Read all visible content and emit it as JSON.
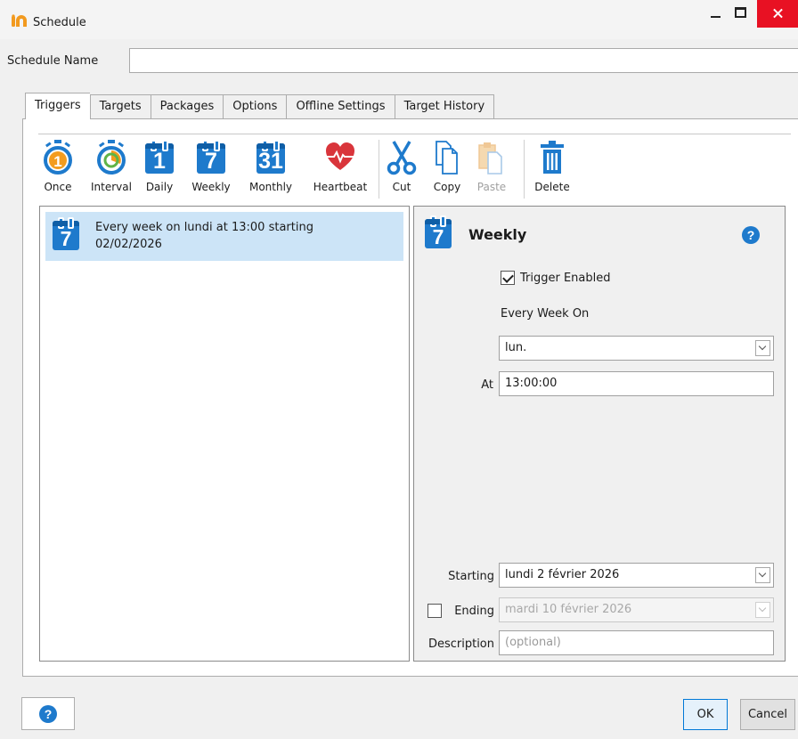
{
  "window": {
    "title": "Schedule"
  },
  "schedule_name": {
    "label": "Schedule Name",
    "value": ""
  },
  "tabs": [
    {
      "label": "Triggers",
      "active": true
    },
    {
      "label": "Targets"
    },
    {
      "label": "Packages"
    },
    {
      "label": "Options"
    },
    {
      "label": "Offline Settings"
    },
    {
      "label": "Target History"
    }
  ],
  "toolbar": {
    "once": {
      "label": "Once",
      "icon": "stopwatch-once-icon"
    },
    "interval": {
      "label": "Interval",
      "icon": "stopwatch-interval-icon"
    },
    "daily": {
      "label": "Daily",
      "icon": "calendar-day-icon",
      "number": "1"
    },
    "weekly": {
      "label": "Weekly",
      "icon": "calendar-week-icon",
      "number": "7"
    },
    "monthly": {
      "label": "Monthly",
      "icon": "calendar-month-icon",
      "number": "31"
    },
    "heartbeat": {
      "label": "Heartbeat",
      "icon": "heartbeat-icon"
    },
    "cut": {
      "label": "Cut",
      "icon": "scissors-icon"
    },
    "copy": {
      "label": "Copy",
      "icon": "copy-icon"
    },
    "paste": {
      "label": "Paste",
      "icon": "paste-icon",
      "disabled": true
    },
    "delete": {
      "label": "Delete",
      "icon": "trash-icon"
    }
  },
  "triggers_list": [
    {
      "icon_number": "7",
      "text": "Every week on lundi at 13:00 starting 02/02/2026"
    }
  ],
  "detail": {
    "icon_number": "7",
    "title": "Weekly",
    "trigger_enabled": {
      "label": "Trigger Enabled",
      "checked": true
    },
    "every_week_on_label": "Every Week On",
    "day_selected": "lun.",
    "at_label": "At",
    "at_value": "13:00:00",
    "starting_label": "Starting",
    "starting_value": "lundi 2 février 2026",
    "ending_label": "Ending",
    "ending_checked": false,
    "ending_value": "mardi 10 février 2026",
    "description_label": "Description",
    "description_placeholder": "(optional)"
  },
  "buttons": {
    "help": "?",
    "ok": "OK",
    "cancel": "Cancel"
  },
  "colors": {
    "accent": "#1e7acc",
    "close": "#e81123",
    "selection": "#cce4f7",
    "heart": "#d9353b"
  }
}
